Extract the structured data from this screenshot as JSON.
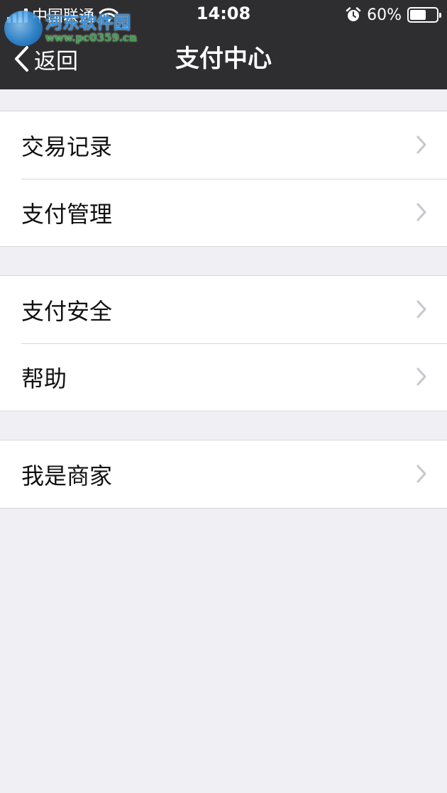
{
  "status_bar": {
    "carrier": "中国联通",
    "time": "14:08",
    "battery_percent": "60%",
    "battery_level": 0.6,
    "icons": [
      "signal-icon",
      "wifi-icon",
      "alarm-icon",
      "battery-icon"
    ]
  },
  "watermark": {
    "title": "河东软件园",
    "url": "www.pc0359.cn"
  },
  "nav": {
    "back_label": "返回",
    "title": "支付中心"
  },
  "groups": [
    {
      "items": [
        {
          "label": "交易记录"
        },
        {
          "label": "支付管理"
        }
      ]
    },
    {
      "items": [
        {
          "label": "支付安全"
        },
        {
          "label": "帮助"
        }
      ]
    },
    {
      "items": [
        {
          "label": "我是商家"
        }
      ]
    }
  ],
  "colors": {
    "nav_background": "#2e2e30",
    "page_background": "#efeff4",
    "chevron": "#c7c7cc",
    "separator": "#d8d8dc"
  }
}
